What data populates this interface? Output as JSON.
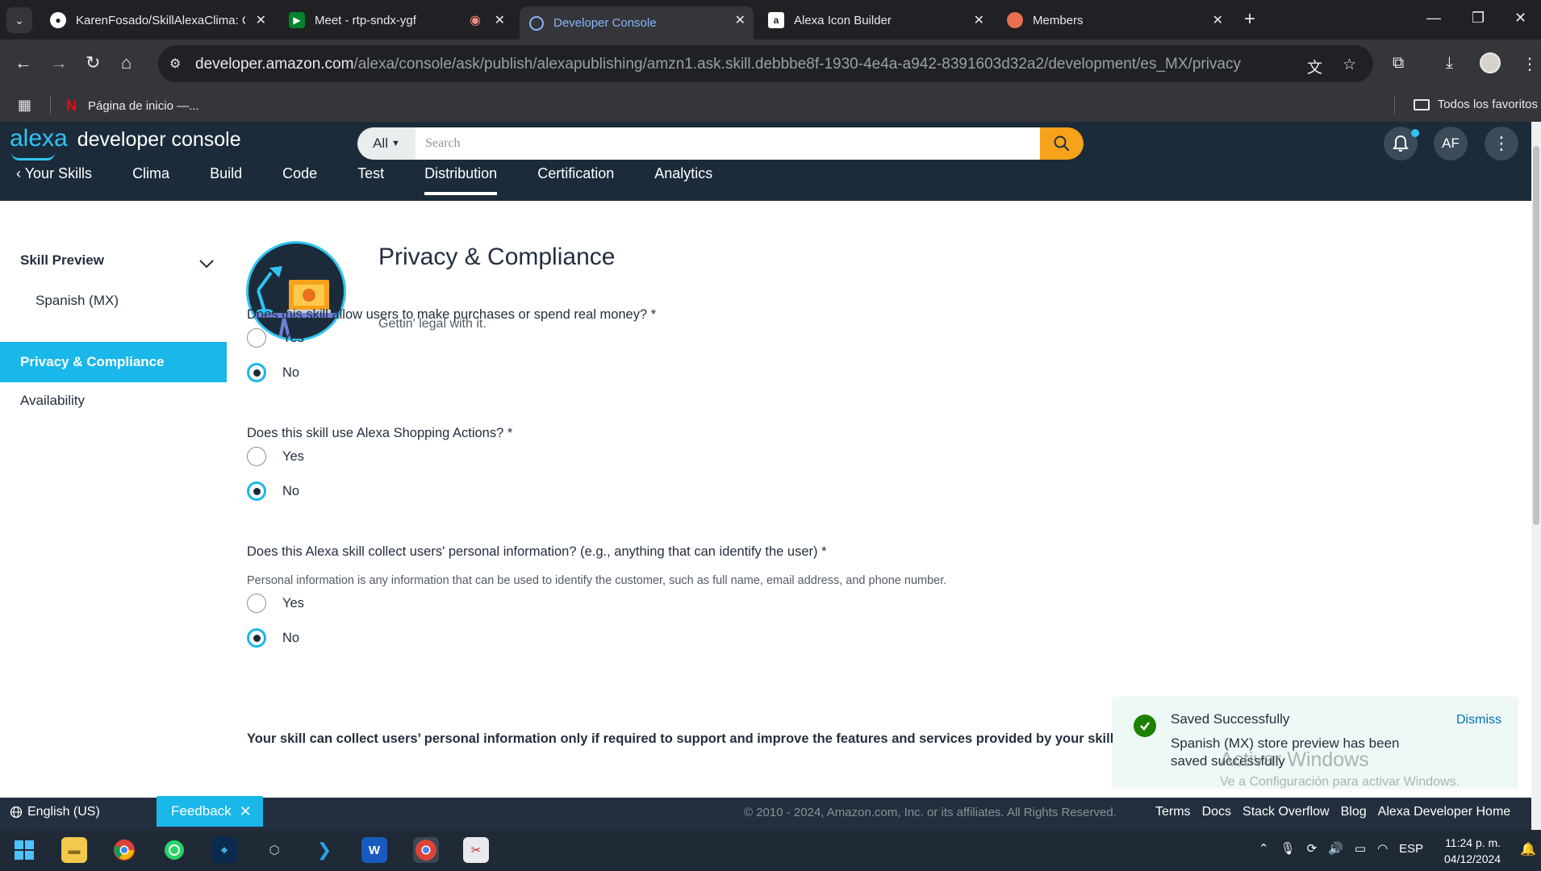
{
  "browser": {
    "tabs": [
      {
        "title": "KarenFosado/SkillAlexaClima: C",
        "icon": "github-icon"
      },
      {
        "title": "Meet - rtp-sndx-ygf",
        "icon": "meet-icon"
      },
      {
        "title": "Developer Console",
        "icon": "alexa-icon"
      },
      {
        "title": "Alexa Icon Builder",
        "icon": "amazon-icon"
      },
      {
        "title": "Members",
        "icon": "members-icon"
      }
    ],
    "url_domain": "developer.amazon.com",
    "url_path": "/alexa/console/ask/publish/alexapublishing/amzn1.ask.skill.debbbe8f-1930-4e4a-a942-8391603d32a2/development/es_MX/privacy",
    "bookmarks": {
      "item": "Página de inicio —...",
      "favorites": "Todos los favoritos"
    }
  },
  "header": {
    "logo_alexa": "alexa",
    "logo_text": "developer console",
    "search_scope": "All",
    "search_placeholder": "Search",
    "user_initials": "AF",
    "nav": {
      "back": "Your Skills",
      "items": [
        "Clima",
        "Build",
        "Code",
        "Test",
        "Distribution",
        "Certification",
        "Analytics"
      ],
      "active": "Distribution"
    }
  },
  "sidebar": {
    "section": "Skill Preview",
    "sub_item": "Spanish (MX)",
    "active_item": "Privacy & Compliance",
    "item": "Availability"
  },
  "page": {
    "title": "Privacy & Compliance",
    "subtitle": "Gettin' legal with it.",
    "questions": [
      {
        "text": "Does this skill allow users to make purchases or spend real money? *",
        "options": [
          "Yes",
          "No"
        ],
        "selected": "No"
      },
      {
        "text": "Does this skill use Alexa Shopping Actions? *",
        "options": [
          "Yes",
          "No"
        ],
        "selected": "No"
      },
      {
        "text": "Does this Alexa skill collect users' personal information? (e.g., anything that can identify the user) *",
        "helper": "Personal information is any information that can be used to identify the customer, such as full name, email address, and phone number.",
        "options": [
          "Yes",
          "No"
        ],
        "selected": "No"
      }
    ],
    "notice": "Your skill can collect users’ personal information only if required to support and improve the features and services provided by your skill."
  },
  "toast": {
    "title": "Saved Successfully",
    "message": "Spanish (MX) store preview has been saved successfully",
    "dismiss": "Dismiss"
  },
  "watermark": {
    "title": "Activar Windows",
    "subtitle": "Ve a Configuración para activar Windows."
  },
  "footer": {
    "language": "English (US)",
    "feedback": "Feedback",
    "copyright": "© 2010 - 2024, Amazon.com, Inc. or its affiliates. All Rights Reserved.",
    "links": [
      "Terms",
      "Docs",
      "Stack Overflow",
      "Blog",
      "Alexa Developer Home"
    ]
  },
  "taskbar": {
    "language": "ESP",
    "time": "11:24 p. m.",
    "date": "04/12/2024"
  },
  "colors": {
    "header_bg": "#1b2b3a",
    "accent": "#1ab7ea",
    "search_button": "#f7a21b",
    "success": "#1d8102"
  }
}
